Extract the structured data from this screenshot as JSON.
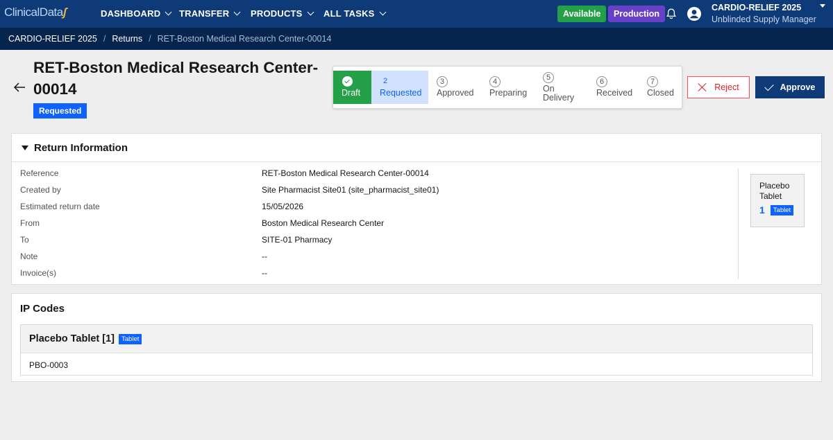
{
  "nav": {
    "logo": "ClinicalData",
    "items": [
      {
        "label": "DASHBOARD"
      },
      {
        "label": "TRANSFER"
      },
      {
        "label": "PRODUCTS"
      },
      {
        "label": "ALL TASKS"
      }
    ],
    "available_label": "Available",
    "production_label": "Production",
    "study_name": "CARDIO-RELIEF 2025",
    "user_role": "Unblinded Supply Manager",
    "colors": {
      "bar": "#0f3a78",
      "available": "#24a148",
      "production": "#6941c6"
    }
  },
  "breadcrumb": {
    "items": [
      "CARDIO-RELIEF 2025",
      "Returns",
      "RET-Boston Medical Research Center-00014"
    ],
    "separator": "/"
  },
  "header": {
    "title": "RET-Boston Medical Research Center-00014",
    "status": "Requested"
  },
  "stepper": {
    "steps": [
      {
        "num": "",
        "label": "Draft",
        "state": "done"
      },
      {
        "num": "2",
        "label": "Requested",
        "state": "current"
      },
      {
        "num": "3",
        "label": "Approved",
        "state": "pending"
      },
      {
        "num": "4",
        "label": "Preparing",
        "state": "pending"
      },
      {
        "num": "5",
        "label": "On Delivery",
        "state": "pending"
      },
      {
        "num": "6",
        "label": "Received",
        "state": "pending"
      },
      {
        "num": "7",
        "label": "Closed",
        "state": "pending"
      }
    ]
  },
  "actions": {
    "reject_label": "Reject",
    "approve_label": "Approve"
  },
  "return_info": {
    "title": "Return Information",
    "rows": [
      {
        "key": "Reference",
        "value": "RET-Boston Medical Research Center-00014"
      },
      {
        "key": "Created by",
        "value": "Site Pharmacist Site01 (site_pharmacist_site01)"
      },
      {
        "key": "Estimated return date",
        "value": "15/05/2026"
      },
      {
        "key": "From",
        "value": "Boston Medical Research Center"
      },
      {
        "key": "To",
        "value": "SITE-01 Pharmacy"
      },
      {
        "key": "Note",
        "value": "--"
      },
      {
        "key": "Invoice(s)",
        "value": "--"
      }
    ],
    "product_card": {
      "name_line1": "Placebo",
      "name_line2": "Tablet",
      "quantity": "1",
      "form": "Tablet"
    }
  },
  "ip_codes": {
    "title": "IP Codes",
    "group": {
      "name": "Placebo Tablet [1]",
      "form": "Tablet",
      "codes": [
        "PBO-0003"
      ]
    }
  }
}
